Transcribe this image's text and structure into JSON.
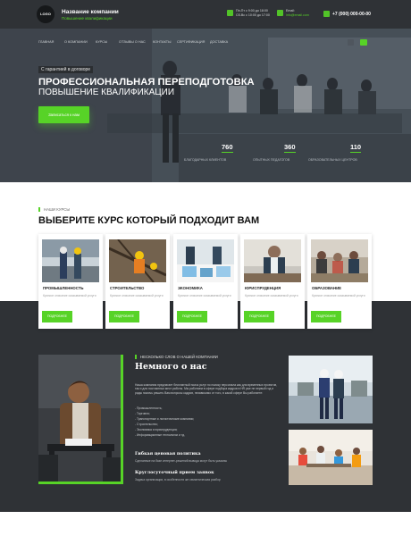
{
  "header": {
    "logo_text": "LOGO",
    "company_name": "Название компании",
    "company_tagline": "Повышение квалификации",
    "schedule_line1": "Пн-Пт с 9:00 до 18:00",
    "schedule_line2": "Сб-Вс с 10:00 до 17:00",
    "email_label": "Email:",
    "email_value": "info@email.com",
    "phone": "+7 (000) 000-00-00"
  },
  "nav": {
    "items": [
      "ГЛАВНАЯ",
      "О КОМПАНИИ",
      "КУРСЫ",
      "ОТЗЫВЫ О НАС",
      "КОНТАКТЫ",
      "СЕРТИФИКАЦИЯ",
      "ДОСТАВКА"
    ]
  },
  "hero": {
    "badge": "С гарантией в договоре",
    "title_line1": "ПРОФЕССИОНАЛЬНАЯ ПЕРЕПОДГОТОВКА",
    "title_line2": "ПОВЫШЕНИЕ КВАЛИФИКАЦИИ",
    "cta": "Записаться к нам",
    "stats": [
      {
        "value": "760",
        "label": "БЛАГОДАРНЫХ КЛИЕНТОВ"
      },
      {
        "value": "360",
        "label": "ОПЫТНЫХ ПЕДАГОГОВ"
      },
      {
        "value": "110",
        "label": "ОБРАЗОВАТЕЛЬНЫХ ЦЕНТРОВ"
      }
    ]
  },
  "courses": {
    "eyebrow": "НАШИ КУРСЫ",
    "title": "ВЫБЕРИТЕ КУРС КОТОРЫЙ ПОДХОДИТ ВАМ",
    "items": [
      {
        "title": "ПРОМЫШЛЕННОСТЬ",
        "desc": "Краткое описание оказываемой услуги",
        "button": "ПОДРОБНЕЕ"
      },
      {
        "title": "СТРОИТЕЛЬСТВО",
        "desc": "Краткое описание оказываемой услуги",
        "button": "ПОДРОБНЕЕ"
      },
      {
        "title": "ЭКОНОМИКА",
        "desc": "Краткое описание оказываемой услуги",
        "button": "ПОДРОБНЕЕ"
      },
      {
        "title": "ЮРИСПРУДЕНЦИЯ",
        "desc": "Краткое описание оказываемой услуги",
        "button": "ПОДРОБНЕЕ"
      },
      {
        "title": "ОБРАЗОВАНИЕ",
        "desc": "Краткое описание оказываемой услуги",
        "button": "ПОДРОБНЕЕ"
      }
    ]
  },
  "about": {
    "eyebrow": "НЕСКОЛЬКО СЛОВ О НАШЕЙ КОМПАНИИ",
    "title": "Немного о нас",
    "paragraph": "Наша компания предлагает бесплатный поиск услуг по поиску персонала как для временных проектов, так и для постоянных мест работы. Мы работаем в сфере подбора кадров в HR уже не первый год и рады помочь решить Вам вопросы кадров, независимо от того, в какой сфере Вы работаете:",
    "list": [
      "- Промышленность;",
      "- Торговля;",
      "- Транспортные и логистические компании;",
      "- Строительство;",
      "- Экономика и юриспруденция;",
      "- Информационные технологии и тд."
    ],
    "feature1_title": "Гибкая ценовая политика",
    "feature1_text": "Сделанные на базе интернет-решений вывода могут быть указаны",
    "feature2_title": "Круглосуточный прием заявок",
    "feature2_text": "Задача организации, в особенности же семантическая разбор"
  },
  "colors": {
    "accent": "#57d327",
    "dark": "#2f3236"
  }
}
